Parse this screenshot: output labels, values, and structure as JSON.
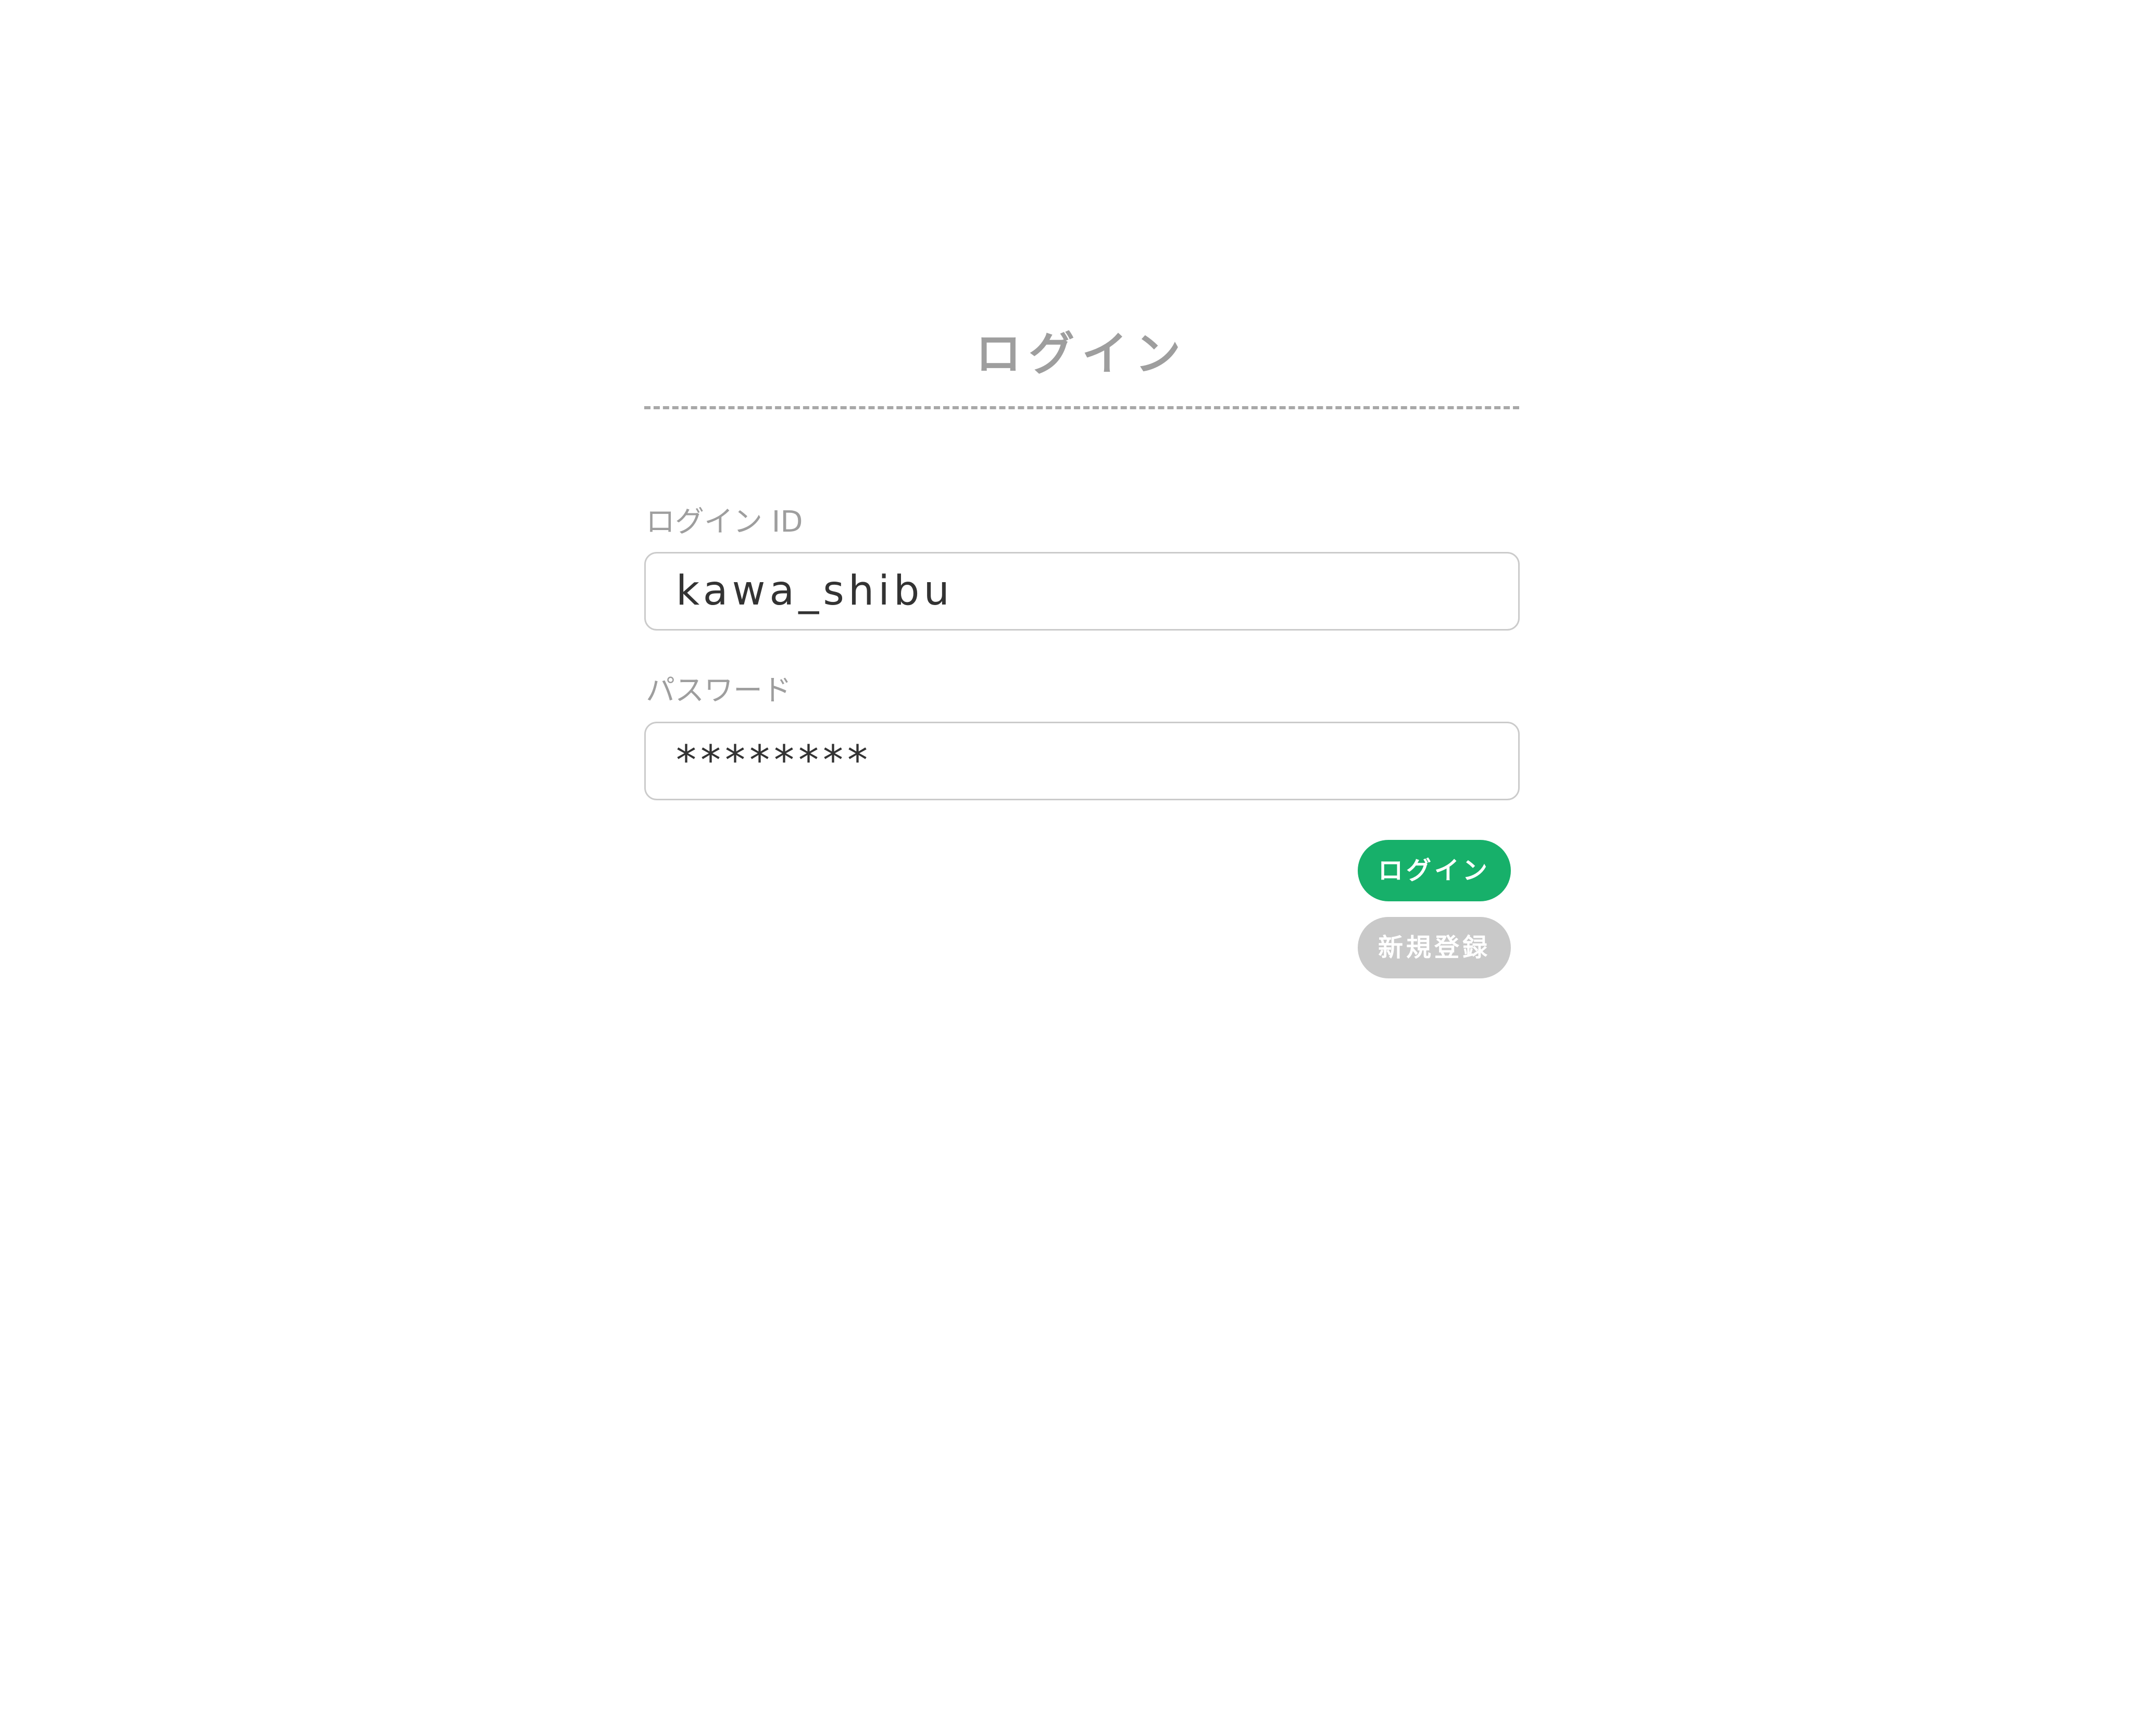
{
  "page": {
    "title": "ログイン"
  },
  "form": {
    "login_id_label": "ログイン ID",
    "login_id_value": "kawa_shibu",
    "password_label": "パスワード",
    "password_value": "********"
  },
  "buttons": {
    "login": "ログイン",
    "register": "新規登録"
  },
  "colors": {
    "accent": "#17b06a",
    "secondary": "#c9c9c9",
    "muted_text": "#9e9e9e"
  }
}
